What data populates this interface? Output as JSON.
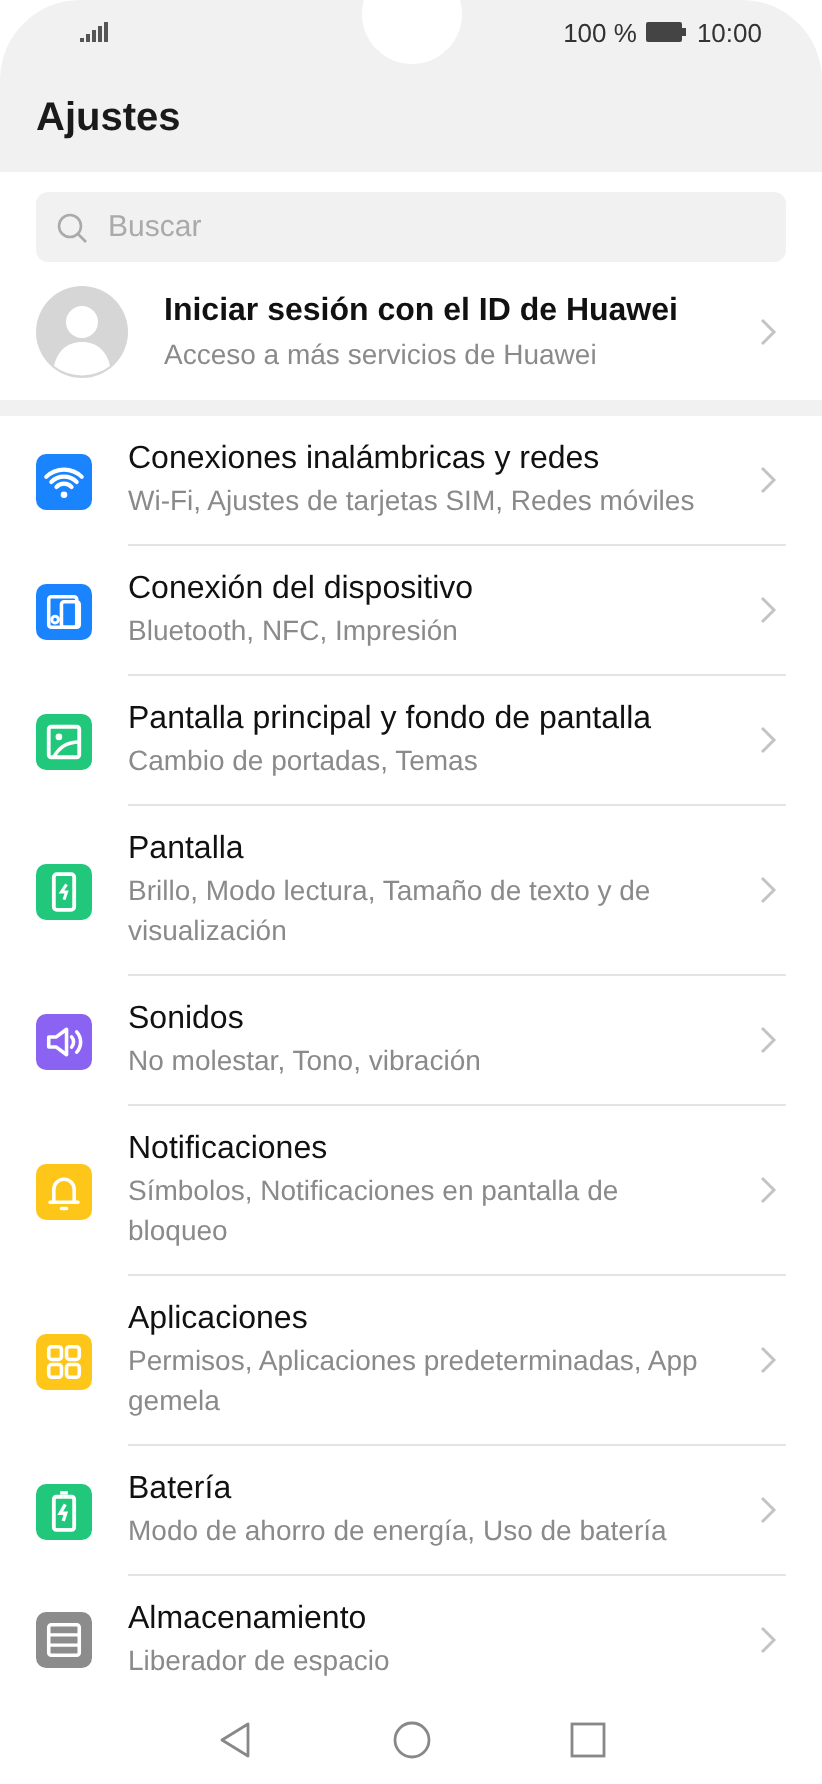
{
  "status_bar": {
    "battery": "100 %",
    "time": "10:00"
  },
  "title": "Ajustes",
  "search": {
    "placeholder": "Buscar"
  },
  "account": {
    "title": "Iniciar sesión con el ID de Huawei",
    "subtitle": "Acceso a más servicios de Huawei"
  },
  "items": [
    {
      "kind": "wifi",
      "color": "#1a84ff",
      "title": "Conexiones inalámbricas y redes",
      "subtitle": "Wi-Fi, Ajustes de tarjetas SIM, Redes móviles"
    },
    {
      "kind": "devices",
      "color": "#1a84ff",
      "title": "Conexión del dispositivo",
      "subtitle": "Bluetooth, NFC, Impresión"
    },
    {
      "kind": "wallpaper",
      "color": "#21c77a",
      "title": "Pantalla principal y fondo de pantalla",
      "subtitle": "Cambio de portadas, Temas"
    },
    {
      "kind": "display",
      "color": "#21c77a",
      "title": "Pantalla",
      "subtitle": "Brillo, Modo lectura, Tamaño de texto y de visualización"
    },
    {
      "kind": "sound",
      "color": "#8a63f2",
      "title": "Sonidos",
      "subtitle": "No molestar, Tono, vibración"
    },
    {
      "kind": "bell",
      "color": "#ffc61a",
      "title": "Notificaciones",
      "subtitle": "Símbolos, Notificaciones en pantalla de bloqueo"
    },
    {
      "kind": "apps",
      "color": "#ffc61a",
      "title": "Aplicaciones",
      "subtitle": "Permisos, Aplicaciones predeterminadas, App gemela"
    },
    {
      "kind": "battery",
      "color": "#21c77a",
      "title": "Batería",
      "subtitle": "Modo de ahorro de energía, Uso de batería"
    },
    {
      "kind": "storage",
      "color": "#8c8c8c",
      "title": "Almacenamiento",
      "subtitle": "Liberador de espacio"
    }
  ]
}
